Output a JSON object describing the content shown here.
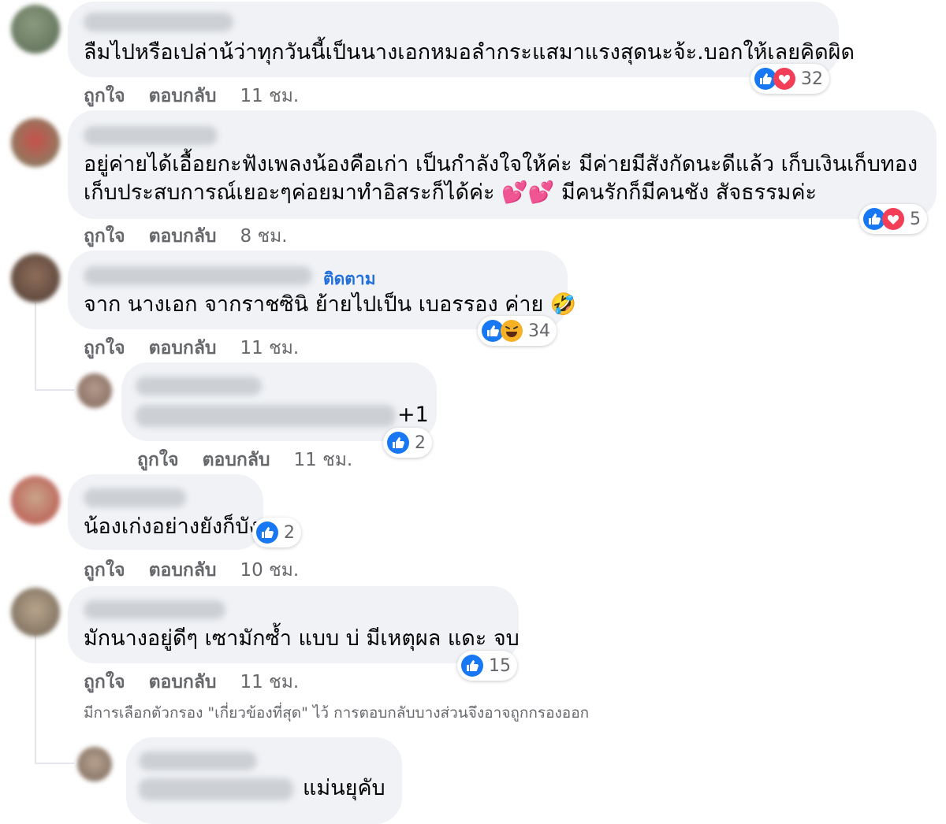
{
  "comments": [
    {
      "text": "ลืมไปหรือเปล่าน้ว่าทุกวันนี้เป็นนางเอกหมอลำกระแสมาแรงสุดนะจ้ะ.บอกให้เลยคิดผิด",
      "like": "ถูกใจ",
      "reply": "ตอบกลับ",
      "time": "11 ชม.",
      "reaction_count": "32",
      "reactions": [
        "like-icon",
        "love-icon"
      ]
    },
    {
      "text_line1": "อยู่ค่ายได้เอื้อยกะฟังเพลงน้องคือเก่า เป็นกำลังใจให้ค่ะ มีค่ายมีสังกัดนะดีแล้ว เก็บเงินเก็บทอง",
      "text_line2": "เก็บประสบการณ์เยอะๆค่อยมาทำอิสระก็ได้ค่ะ 💕💕 มีคนรักก็มีคนชัง สัจธรรมค่ะ",
      "like": "ถูกใจ",
      "reply": "ตอบกลับ",
      "time": "8 ชม.",
      "reaction_count": "5",
      "reactions": [
        "like-icon",
        "love-icon"
      ]
    },
    {
      "follow": "ติดตาม",
      "text": "จาก นางเอก จากราชซินิ ย้ายไปเป็น เบอรรอง ค่าย 🤣",
      "like": "ถูกใจ",
      "reply": "ตอบกลับ",
      "time": "11 ชม.",
      "reaction_count": "34",
      "reactions": [
        "like-icon",
        "haha-icon"
      ]
    },
    {
      "plus": "+1",
      "like": "ถูกใจ",
      "reply": "ตอบกลับ",
      "time": "11 ชม.",
      "reaction_count": "2",
      "reactions": [
        "like-icon"
      ]
    },
    {
      "text": "น้องเก่งอย่างยังก็บัง",
      "like": "ถูกใจ",
      "reply": "ตอบกลับ",
      "time": "10 ชม.",
      "reaction_count": "2",
      "reactions": [
        "like-icon"
      ]
    },
    {
      "text": "มักนางอยู่ดีๆ เซามักซ้ำ แบบ บ่ มีเหตุผล แดะ จบ",
      "like": "ถูกใจ",
      "reply": "ตอบกลับ",
      "time": "11 ชม.",
      "reaction_count": "15",
      "reactions": [
        "like-icon"
      ]
    },
    {
      "text": "แม่นยุคับ"
    }
  ],
  "filter_note": "มีการเลือกตัวกรอง \"เกี่ยวข้องที่สุด\" ไว้ การตอบกลับบางส่วนจึงอาจถูกกรองออก",
  "colors": {
    "like": "#1877f2",
    "love": "#f33e58",
    "haha": "#f7b125",
    "link": "#216fdb"
  }
}
